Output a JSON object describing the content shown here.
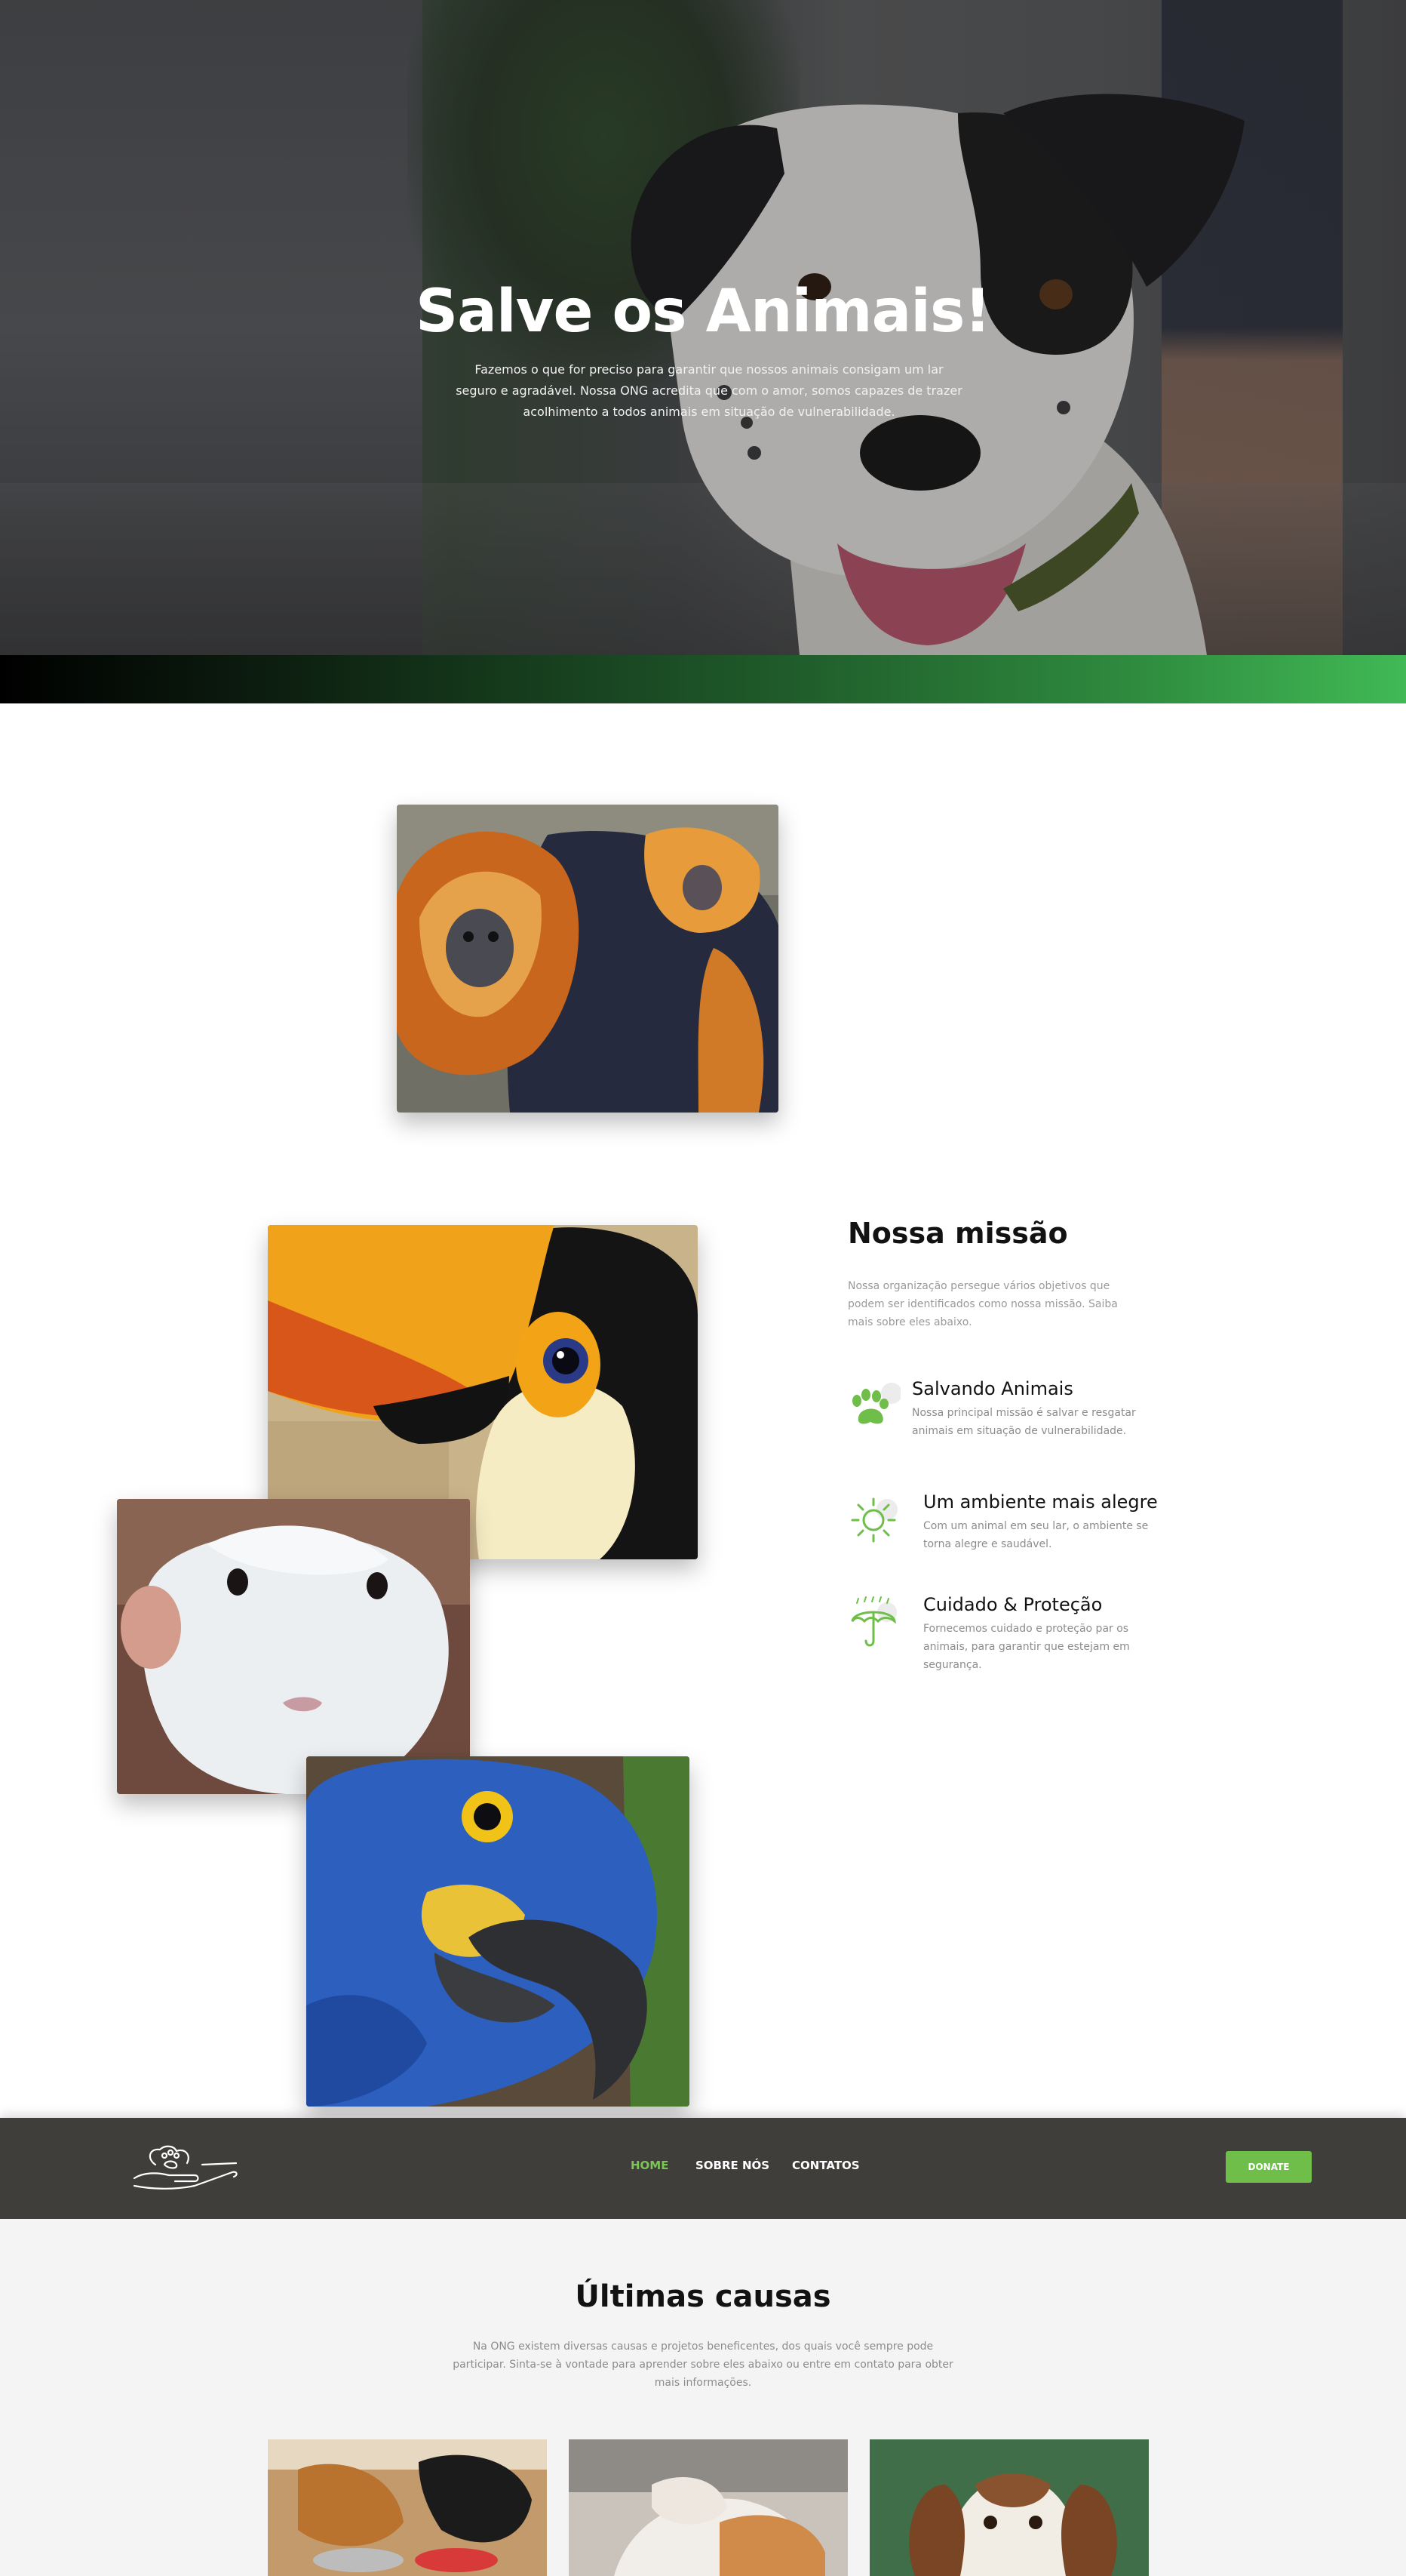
{
  "hero": {
    "title": "Salve os Animais!",
    "text": "Fazemos o que for preciso para garantir que nossos animais consigam um lar seguro e agradável. Nossa ONG acredita que com o amor, somos capazes de trazer acolhimento a todos animais em situação de vulnerabilidade."
  },
  "mission": {
    "title": "Nossa missão",
    "description": "Nossa organização persegue vários objetivos que podem ser identificados como nossa missão. Saiba mais sobre eles abaixo.",
    "features": [
      {
        "icon": "paw-icon",
        "title": "Salvando Animais",
        "text": "Nossa principal missão é salvar e resgatar animais em situação de vulnerabilidade."
      },
      {
        "icon": "sun-icon",
        "title": "Um ambiente mais alegre",
        "text": "Com um animal em seu lar, o ambiente se torna alegre e saudável."
      },
      {
        "icon": "umbrella-icon",
        "title": "Cuidado & Proteção",
        "text": "Fornecemos cuidado e proteção par os animais, para garantir que estejam em segurança."
      }
    ]
  },
  "nav": {
    "logo": "hand-paw-logo",
    "links": [
      "HOME",
      "SOBRE NÓS",
      "CONTATOS"
    ],
    "donate": "DONATE"
  },
  "causes": {
    "title": "Últimas causas",
    "text": "Na ONG existem diversas causas e projetos beneficentes, dos quais você sempre pode participar. Sinta-se à vontade para aprender sobre eles abaixo ou entre em contato para obter mais informações."
  },
  "colors": {
    "accent": "#6fbe4a",
    "nav_background": "#3f3e3b",
    "active_link": "#7cc455"
  }
}
